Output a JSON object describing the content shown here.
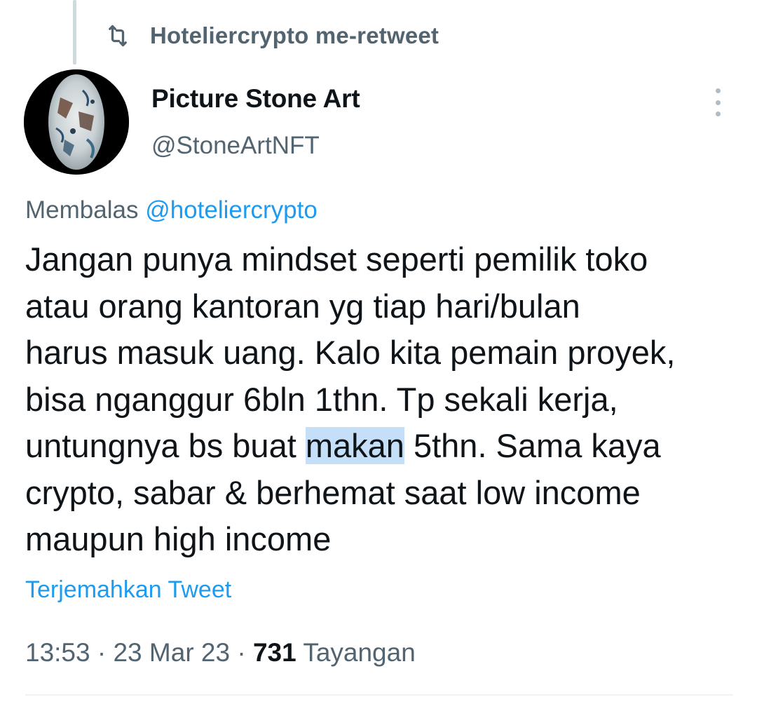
{
  "retweet": {
    "icon": "retweet-icon",
    "text": "Hoteliercrypto me-retweet"
  },
  "author": {
    "display_name": "Picture Stone Art",
    "handle": "@StoneArtNFT",
    "avatar": "stone-art-avatar"
  },
  "more_button": {
    "icon": "more-vertical-icon"
  },
  "reply": {
    "prefix": "Membalas",
    "mention": "@hoteliercrypto"
  },
  "tweet": {
    "lines": [
      {
        "text": "Jangan punya mindset seperti pemilik toko"
      },
      {
        "text": "atau orang kantoran yg tiap hari/bulan"
      },
      {
        "text": "harus masuk uang. Kalo kita pemain proyek,"
      },
      {
        "text": "bisa nganggur 6bln 1thn. Tp sekali kerja,"
      },
      {
        "before": "untungnya bs buat ",
        "highlight": "makan",
        "after": " 5thn. Sama kaya"
      },
      {
        "text": "crypto, sabar & berhemat saat low income"
      },
      {
        "text": "maupun high income"
      }
    ]
  },
  "translate_label": "Terjemahkan Tweet",
  "meta": {
    "time": "13:53",
    "separator": " · ",
    "date": "23 Mar 23",
    "views_count": "731",
    "views_label": "Tayangan"
  },
  "colors": {
    "text_primary": "#0f1419",
    "text_secondary": "#536471",
    "link": "#1d9bf0",
    "highlight": "#c4dff7"
  }
}
